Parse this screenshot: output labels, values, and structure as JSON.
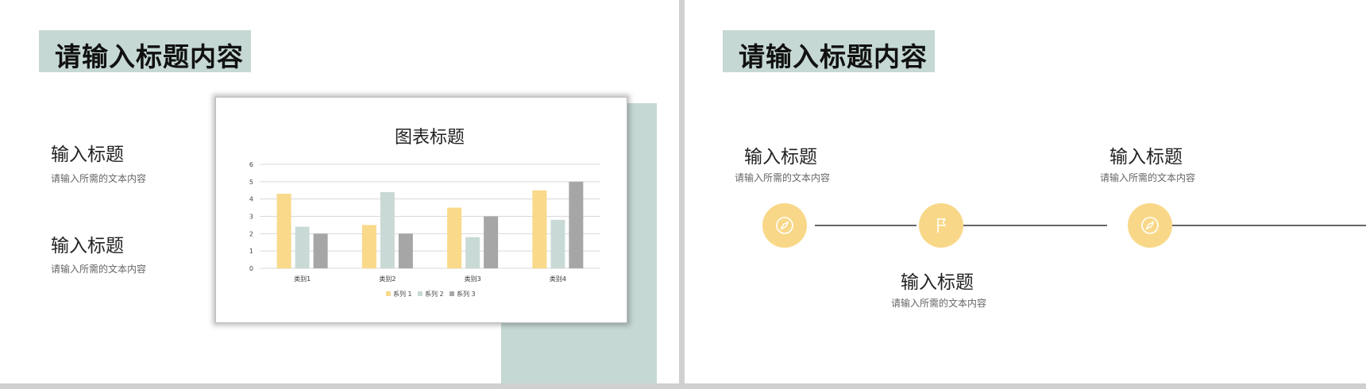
{
  "left_slide": {
    "title": "请输入标题内容",
    "items": [
      {
        "title": "输入标题",
        "desc": "请输入所需的文本内容"
      },
      {
        "title": "输入标题",
        "desc": "请输入所需的文本内容"
      }
    ]
  },
  "chart_data": {
    "type": "bar",
    "title": "图表标题",
    "categories": [
      "类别1",
      "类别2",
      "类别3",
      "类别4"
    ],
    "series": [
      {
        "name": "系列 1",
        "values": [
          4.3,
          2.5,
          3.5,
          4.5
        ],
        "color": "#f9d98a"
      },
      {
        "name": "系列 2",
        "values": [
          2.4,
          4.4,
          1.8,
          2.8
        ],
        "color": "#c9dad6"
      },
      {
        "name": "系列 3",
        "values": [
          2.0,
          2.0,
          3.0,
          5.0
        ],
        "color": "#a6a6a6"
      }
    ],
    "yticks": [
      "0",
      "1",
      "2",
      "3",
      "4",
      "5",
      "6"
    ],
    "ylim": [
      0,
      6
    ],
    "grid": true,
    "legend": "bottom"
  },
  "right_slide": {
    "title": "请输入标题内容",
    "items": [
      {
        "title": "输入标题",
        "desc": "请输入所需的文本内容"
      },
      {
        "title": "输入标题",
        "desc": "请输入所需的文本内容"
      },
      {
        "title": "输入标题",
        "desc": "请输入所需的文本内容"
      }
    ],
    "icons": [
      "compass-icon",
      "flag-icon",
      "compass-icon"
    ],
    "accent_color": "#f8d888"
  }
}
